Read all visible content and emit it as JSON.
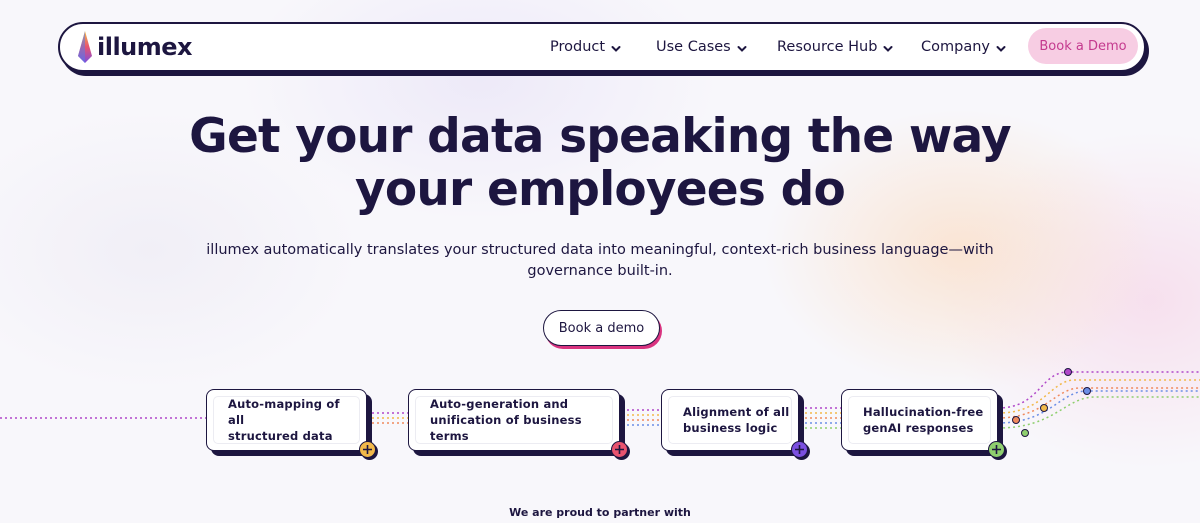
{
  "brand": {
    "name": "illumex"
  },
  "nav": {
    "items": [
      {
        "label": "Product"
      },
      {
        "label": "Use Cases"
      },
      {
        "label": "Resource Hub"
      },
      {
        "label": "Company"
      }
    ],
    "cta_label": "Book a Demo"
  },
  "hero": {
    "title_line1": "Get your data speaking the way",
    "title_line2": "your employees do",
    "subtitle_line1": "illumex automatically translates your structured data into meaningful, context-rich business language—with",
    "subtitle_line2": "governance built-in.",
    "cta_label": "Book a demo"
  },
  "features": [
    {
      "line1": "Auto-mapping of all",
      "line2": "structured data",
      "accent": "#f2b94a",
      "icon": "plus-icon"
    },
    {
      "line1": "Auto-generation and",
      "line2": "unification of business terms",
      "accent": "#e8536f",
      "icon": "plus-icon"
    },
    {
      "line1": "Alignment of all",
      "line2": "business logic",
      "accent": "#7b4fe0",
      "icon": "plus-icon"
    },
    {
      "line1": "Hallucination-free",
      "line2": "genAI responses",
      "accent": "#8fcf6e",
      "icon": "plus-icon"
    }
  ],
  "partners": {
    "heading": "We are proud to partner with"
  },
  "colors": {
    "ink": "#1d1640",
    "pink_cta": "#f7cde3",
    "pink_text": "#c43a8e",
    "line_purple": "#b047c9",
    "line_yellow": "#f2b94a",
    "line_orange": "#f08a5d",
    "line_blue": "#6b8ee6",
    "line_green": "#8fcf6e"
  }
}
